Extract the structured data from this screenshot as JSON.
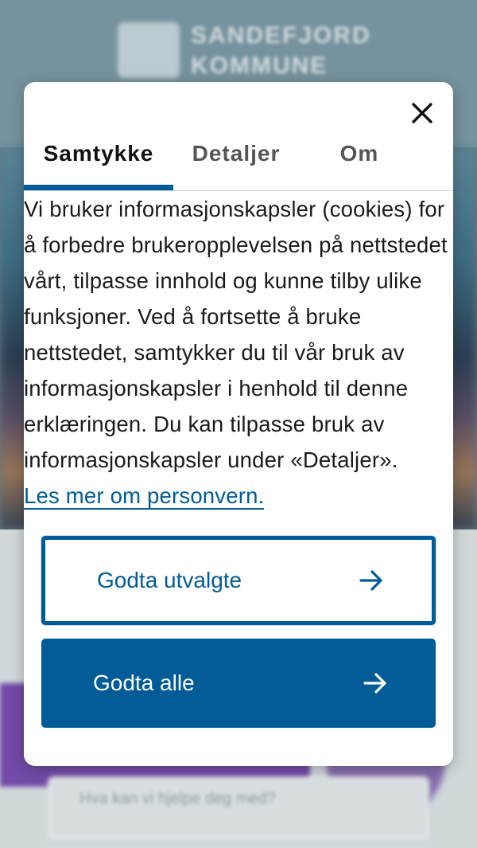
{
  "background": {
    "logo_text_line1": "SANDEFJORD",
    "logo_text_line2": "KOMMUNE",
    "box_text": "Hva kan vi hjelpe deg med?"
  },
  "modal": {
    "close_icon": "close-icon",
    "tabs": [
      {
        "label": "Samtykke",
        "active": true
      },
      {
        "label": "Detaljer",
        "active": false
      },
      {
        "label": "Om",
        "active": false
      }
    ],
    "body_text": "Vi bruker informasjonskapsler (cookies) for å forbedre brukeropplevelsen på nettstedet vårt, tilpasse innhold og kunne tilby ulike funksjoner. Ved å fortsette å bruke nettstedet, samtykker du til vår bruk av informasjonskapsler i henhold til denne erklæringen. Du kan tilpasse bruk av informasjonskapsler under «Detaljer».",
    "privacy_link": "Les mer om personvern.",
    "buttons": {
      "accept_selected": "Godta utvalgte",
      "accept_all": "Godta alle",
      "arrow_icon": "arrow-right-icon"
    }
  },
  "colors": {
    "accent": "#005b96",
    "text": "#1a1a1a",
    "tab_inactive": "#555555"
  }
}
